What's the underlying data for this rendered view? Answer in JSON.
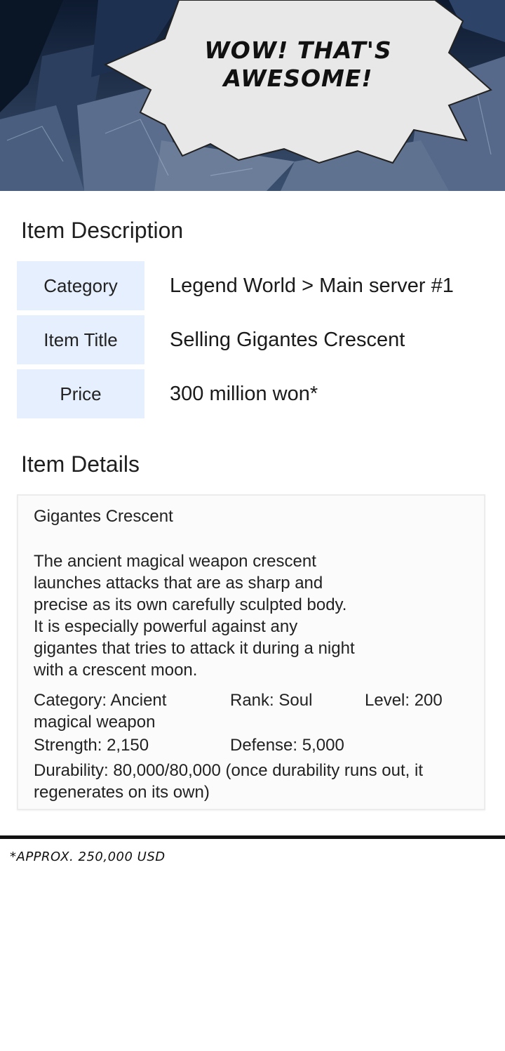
{
  "panel": {
    "speech_lines": [
      "WOW! THAT'S",
      "AWESOME!"
    ]
  },
  "description": {
    "heading": "Item Description",
    "rows": [
      {
        "label": "Category",
        "value": "Legend World > Main server #1"
      },
      {
        "label": "Item Title",
        "value": "Selling Gigantes Crescent"
      },
      {
        "label": "Price",
        "value": "300 million won*"
      }
    ]
  },
  "details": {
    "heading": "Item Details",
    "name": "Gigantes Crescent",
    "description_lines": [
      "The ancient magical weapon crescent",
      "launches attacks that are as sharp and",
      "precise as its own carefully sculpted body.",
      "It is especially powerful against any",
      "gigantes that tries to attack it during a night",
      "with a crescent moon."
    ],
    "stats": {
      "category": "Category: Ancient magical weapon",
      "rank": "Rank: Soul",
      "level": "Level: 200",
      "strength": "Strength: 2,150",
      "defense": "Defense: 5,000",
      "durability": "Durability: 80,000/80,000 (once durability runs out, it regenerates on its own)"
    }
  },
  "footnote": "*APPROX. 250,000 USD",
  "colors": {
    "label_bg": "#e6effd",
    "panel_dark": "#1a2a44",
    "divider": "#111111"
  }
}
